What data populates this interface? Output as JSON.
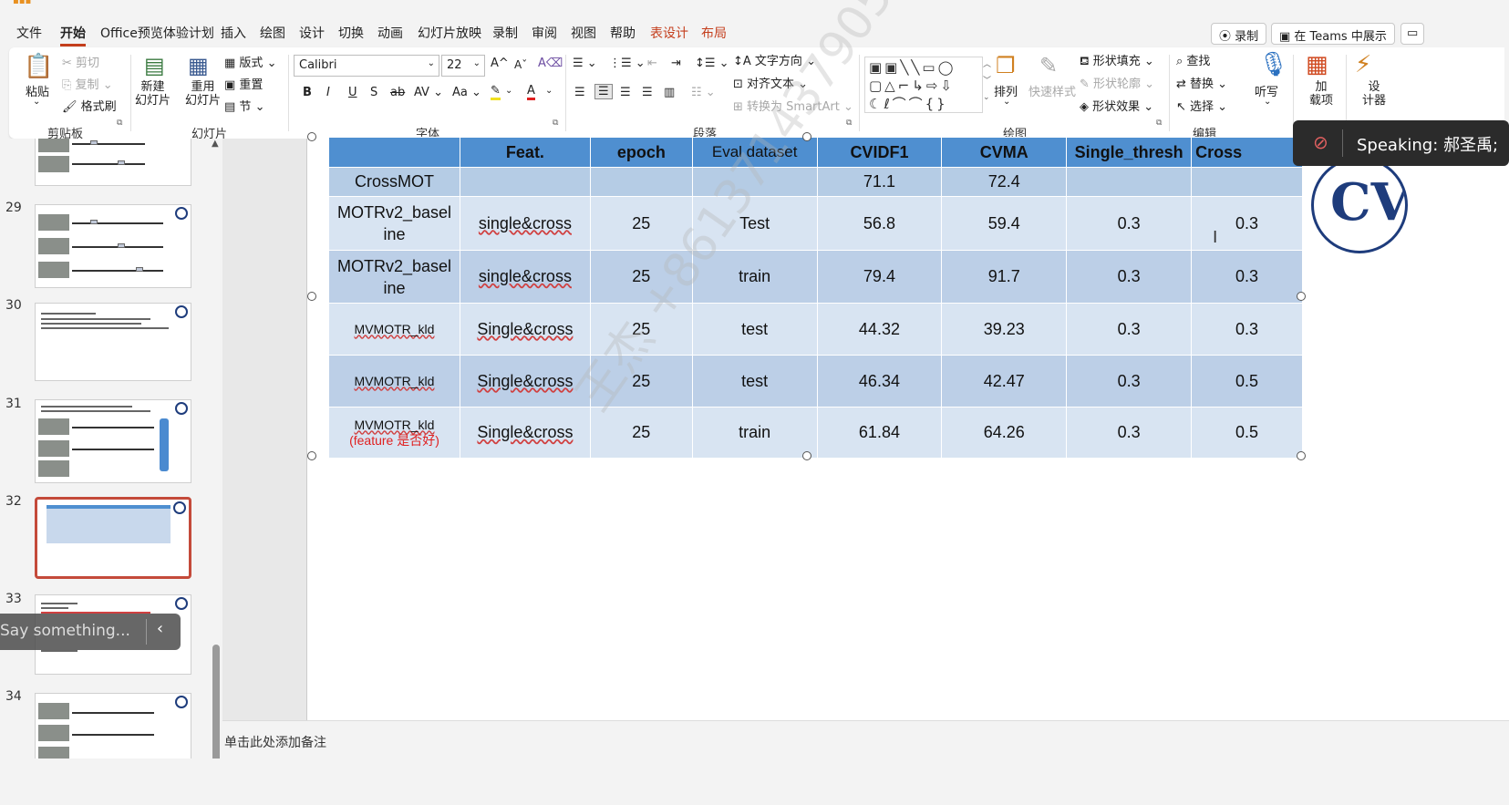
{
  "menu": {
    "tabs": [
      "文件",
      "开始",
      "Office预览体验计划",
      "插入",
      "绘图",
      "设计",
      "切换",
      "动画",
      "幻灯片放映",
      "录制",
      "审阅",
      "视图",
      "帮助"
    ],
    "active_tab": "开始",
    "context_tabs": [
      "表设计",
      "布局"
    ],
    "record_button": "录制",
    "teams_button": "在 Teams 中展示"
  },
  "ribbon": {
    "clipboard": {
      "paste": "粘贴",
      "cut": "剪切",
      "copy": "复制",
      "format_painter": "格式刷",
      "group": "剪贴板"
    },
    "slides": {
      "new_slide": "新建\n幻灯片",
      "reuse": "重用\n幻灯片",
      "layout": "版式",
      "reset": "重置",
      "section": "节",
      "group": "幻灯片"
    },
    "font": {
      "name": "Calibri",
      "size": "22",
      "group": "字体"
    },
    "paragraph": {
      "text_direction": "文字方向",
      "align_text": "对齐文本",
      "smartart": "转换为 SmartArt",
      "group": "段落"
    },
    "drawing": {
      "arrange": "排列",
      "quick_styles": "快速样式",
      "fill": "形状填充",
      "outline": "形状轮廓",
      "effects": "形状效果",
      "group": "绘图"
    },
    "editing": {
      "find": "查找",
      "replace": "替换",
      "select": "选择",
      "group": "编辑"
    },
    "dictate": "听写",
    "addins": "加\n载项",
    "designer": "设\n计器"
  },
  "speaking": "Speaking: 郝圣禹;",
  "slides_panel": {
    "numbers": [
      "29",
      "30",
      "31",
      "32",
      "33",
      "34"
    ],
    "selected": "32"
  },
  "caption_bar": {
    "placeholder": "Say something..."
  },
  "table": {
    "headers": [
      "",
      "Feat.",
      "epoch",
      "Eval dataset",
      "CVIDF1",
      "CVMA",
      "Single_thresh",
      "Cross"
    ],
    "rows": [
      {
        "name": "CrossMOT",
        "feat": "",
        "epoch": "",
        "eval": "",
        "cvidf1": "71.1",
        "cvma": "72.4",
        "single": "",
        "cross": ""
      },
      {
        "name": "MOTRv2_basel ine",
        "feat": "single&cross",
        "epoch": "25",
        "eval": "Test",
        "cvidf1": "56.8",
        "cvma": "59.4",
        "single": "0.3",
        "cross": "0.3"
      },
      {
        "name": "MOTRv2_basel ine",
        "feat": "single&cross",
        "epoch": "25",
        "eval": "train",
        "cvidf1": "79.4",
        "cvma": "91.7",
        "single": "0.3",
        "cross": "0.3"
      },
      {
        "name": "MVMOTR_kld",
        "feat": "Single&cross",
        "epoch": "25",
        "eval": "test",
        "cvidf1": "44.32",
        "cvma": "39.23",
        "single": "0.3",
        "cross": "0.3"
      },
      {
        "name": "MVMOTR_kld",
        "feat": "Single&cross",
        "epoch": "25",
        "eval": "test",
        "cvidf1": "46.34",
        "cvma": "42.47",
        "single": "0.3",
        "cross": "0.5"
      },
      {
        "name": "MVMOTR_kld",
        "name_note": "(feature 是否好)",
        "feat": "Single&cross",
        "epoch": "25",
        "eval": "train",
        "cvidf1": "61.84",
        "cvma": "64.26",
        "single": "0.3",
        "cross": "0.5"
      }
    ]
  },
  "watermark": "王杰 +8613714379050",
  "notes_placeholder": "单击此处添加备注",
  "colors": {
    "header": "#4f8fd0",
    "accent": "#c43e1c",
    "highlight": "#e02020"
  }
}
